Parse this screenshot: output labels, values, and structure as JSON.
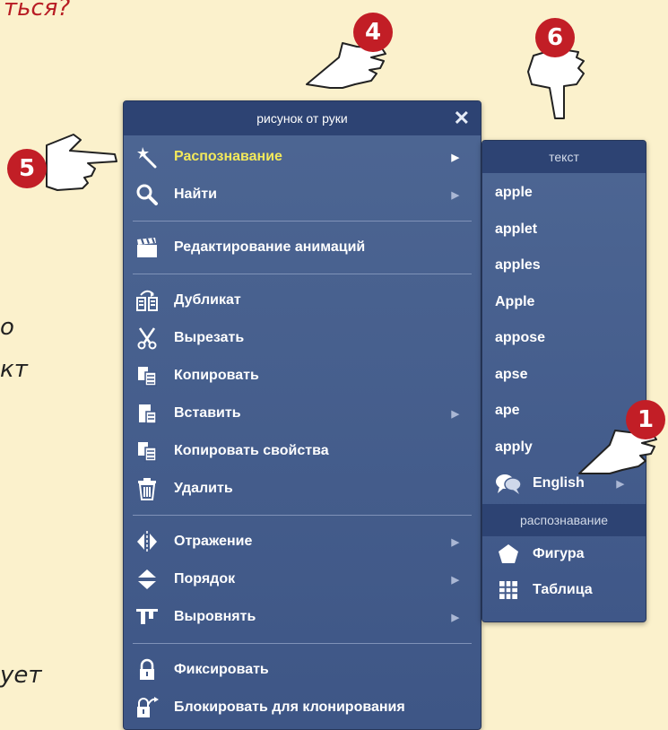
{
  "background": {
    "title_fragment": "ться?",
    "line1": "о",
    "line2": "кт",
    "line3": "ует"
  },
  "markers": {
    "m1": "1",
    "m4": "4",
    "m5": "5",
    "m6": "6"
  },
  "menu": {
    "title": "рисунок от руки",
    "close_glyph": "✕",
    "items": [
      {
        "label": "Распознавание",
        "icon": "magic-wand-icon",
        "submenu": true,
        "active": true
      },
      {
        "label": "Найти",
        "icon": "magnifier-icon",
        "submenu": true
      },
      {
        "label": "Редактирование анимаций",
        "icon": "clapperboard-icon"
      },
      {
        "label": "Дубликат",
        "icon": "duplicate-icon"
      },
      {
        "label": "Вырезать",
        "icon": "scissors-icon"
      },
      {
        "label": "Копировать",
        "icon": "copy-icon"
      },
      {
        "label": "Вставить",
        "icon": "paste-icon",
        "submenu": true
      },
      {
        "label": "Копировать свойства",
        "icon": "copy-properties-icon"
      },
      {
        "label": "Удалить",
        "icon": "trash-icon"
      },
      {
        "label": "Отражение",
        "icon": "flip-icon",
        "submenu": true
      },
      {
        "label": "Порядок",
        "icon": "order-icon",
        "submenu": true
      },
      {
        "label": "Выровнять",
        "icon": "align-icon",
        "submenu": true
      },
      {
        "label": "Фиксировать",
        "icon": "lock-icon"
      },
      {
        "label": "Блокировать для клонирования",
        "icon": "lock-clone-icon"
      }
    ]
  },
  "submenu": {
    "text_header": "текст",
    "words": [
      "apple",
      "applet",
      "apples",
      "Apple",
      "appose",
      "apse",
      "ape",
      "apply"
    ],
    "language": "English",
    "recognition_header": "распознавание",
    "shape": "Фигура",
    "table": "Таблица"
  },
  "colors": {
    "menu_bg": "#465e8d",
    "menu_header": "#2d4373",
    "active_text": "#f3e95b",
    "badge": "#c21e26",
    "page_bg": "#fbf1cc"
  }
}
